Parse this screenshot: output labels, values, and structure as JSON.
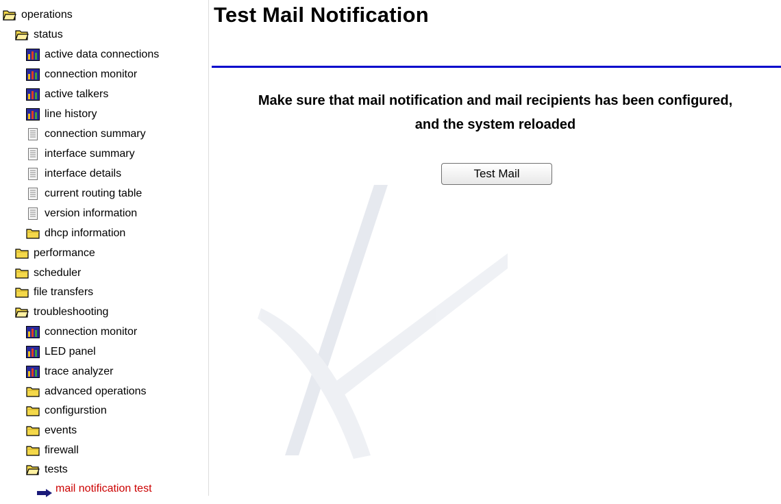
{
  "sidebar": {
    "items": [
      {
        "label": "operations",
        "icon": "open-folder-icon"
      },
      {
        "label": "status",
        "icon": "open-folder-icon"
      },
      {
        "label": "active data connections",
        "icon": "bar-chart-icon"
      },
      {
        "label": "connection monitor",
        "icon": "bar-chart-icon"
      },
      {
        "label": "active talkers",
        "icon": "bar-chart-icon"
      },
      {
        "label": "line history",
        "icon": "bar-chart-icon"
      },
      {
        "label": "connection summary",
        "icon": "document-icon"
      },
      {
        "label": "interface summary",
        "icon": "document-icon"
      },
      {
        "label": "interface details",
        "icon": "document-icon"
      },
      {
        "label": "current routing table",
        "icon": "document-icon"
      },
      {
        "label": "version information",
        "icon": "document-icon"
      },
      {
        "label": "dhcp information",
        "icon": "folder-icon"
      },
      {
        "label": "performance",
        "icon": "folder-icon"
      },
      {
        "label": "scheduler",
        "icon": "folder-icon"
      },
      {
        "label": "file transfers",
        "icon": "folder-icon"
      },
      {
        "label": "troubleshooting",
        "icon": "open-folder-icon"
      },
      {
        "label": "connection monitor",
        "icon": "bar-chart-icon"
      },
      {
        "label": "LED panel",
        "icon": "bar-chart-icon"
      },
      {
        "label": "trace analyzer",
        "icon": "bar-chart-icon"
      },
      {
        "label": "advanced operations",
        "icon": "folder-icon"
      },
      {
        "label": "configurstion",
        "icon": "folder-icon"
      },
      {
        "label": "events",
        "icon": "folder-icon"
      },
      {
        "label": "firewall",
        "icon": "folder-icon"
      },
      {
        "label": "tests",
        "icon": "open-folder-icon"
      },
      {
        "label": "mail notification test",
        "icon": "arrow-right-icon",
        "selected": true
      }
    ]
  },
  "main": {
    "title": "Test Mail Notification",
    "message_line1": "Make sure that mail notification and mail recipients has been configured,",
    "message_line2": "and the system reloaded",
    "button_label": "Test Mail"
  },
  "colors": {
    "title_rule": "#0000cc",
    "selected_item": "#cc0000",
    "folder_yellow": "#f4d84a",
    "chart_blue": "#2a2a9a"
  }
}
